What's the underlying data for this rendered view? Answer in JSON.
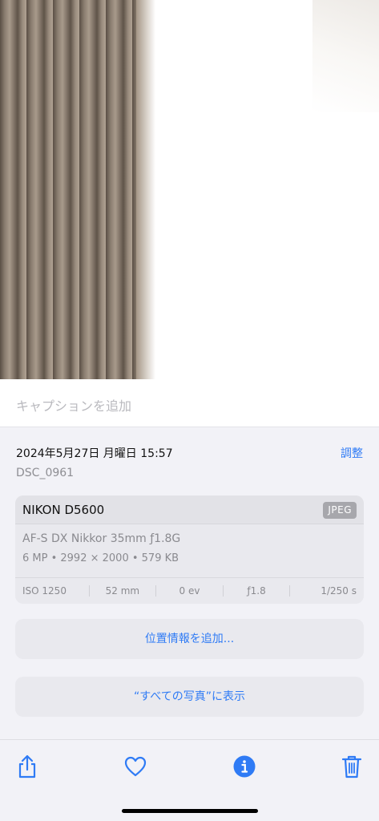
{
  "caption": {
    "placeholder": "キャプションを追加"
  },
  "meta": {
    "datetime": "2024年5月27日 月曜日 15:57",
    "adjust_label": "調整",
    "filename": "DSC_0961"
  },
  "camera": {
    "model": "NIKON D5600",
    "format": "JPEG",
    "lens": "AF-S DX Nikkor 35mm ƒ1.8G",
    "specs": "6 MP • 2992 × 2000 • 579 KB",
    "exif": [
      {
        "label": "ISO 1250"
      },
      {
        "label": "52 mm"
      },
      {
        "label": "0 ev"
      },
      {
        "label": "ƒ1.8"
      },
      {
        "label": "1/250 s"
      }
    ]
  },
  "actions": {
    "add_location": "位置情報を追加...",
    "show_in_all_photos": "“すべての写真”に表示"
  },
  "toolbar": {
    "icons": [
      "share-icon",
      "heart-icon",
      "info-icon",
      "trash-icon"
    ],
    "accent": "#2f7bf5"
  }
}
